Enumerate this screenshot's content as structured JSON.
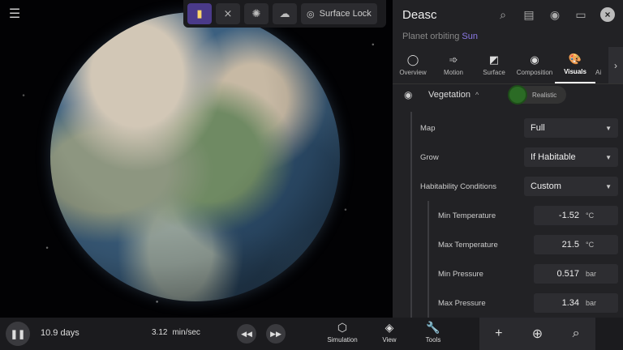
{
  "toolbar": {
    "buttons": [
      {
        "icon": "flashlight-icon",
        "active": true
      },
      {
        "icon": "no-lines-icon",
        "active": false
      },
      {
        "icon": "no-gravity-icon",
        "active": false
      },
      {
        "icon": "cloud-off-icon",
        "active": false
      }
    ],
    "surface_lock_label": "Surface Lock"
  },
  "panel": {
    "title": "Deasc",
    "subtitle_prefix": "Planet orbiting",
    "subtitle_link": "Sun",
    "tabs": [
      {
        "label": "Overview",
        "glyph": "◯"
      },
      {
        "label": "Motion",
        "glyph": "➾"
      },
      {
        "label": "Surface",
        "glyph": "◩"
      },
      {
        "label": "Composition",
        "glyph": "◉"
      },
      {
        "label": "Visuals",
        "glyph": "🎨",
        "active": true
      },
      {
        "label": "Ai",
        "glyph": ""
      }
    ],
    "section": {
      "label": "Vegetation",
      "toggle_label": "Realistic"
    },
    "fields": {
      "map": {
        "label": "Map",
        "value": "Full"
      },
      "grow": {
        "label": "Grow",
        "value": "If Habitable"
      },
      "habitability": {
        "label": "Habitability Conditions",
        "value": "Custom"
      }
    },
    "conditions": [
      {
        "label": "Min Temperature",
        "value": "-1.52",
        "unit": "°C"
      },
      {
        "label": "Max Temperature",
        "value": "21.5",
        "unit": "°C"
      },
      {
        "label": "Min Pressure",
        "value": "0.517",
        "unit": "bar"
      },
      {
        "label": "Max Pressure",
        "value": "1.34",
        "unit": "bar"
      }
    ]
  },
  "bottom": {
    "time": "10.9 days",
    "speed_value": "3.12",
    "speed_unit": "min/sec",
    "menu": [
      {
        "label": "Simulation",
        "glyph": "⬡"
      },
      {
        "label": "View",
        "glyph": "◈"
      },
      {
        "label": "Tools",
        "glyph": "🔧"
      }
    ]
  }
}
